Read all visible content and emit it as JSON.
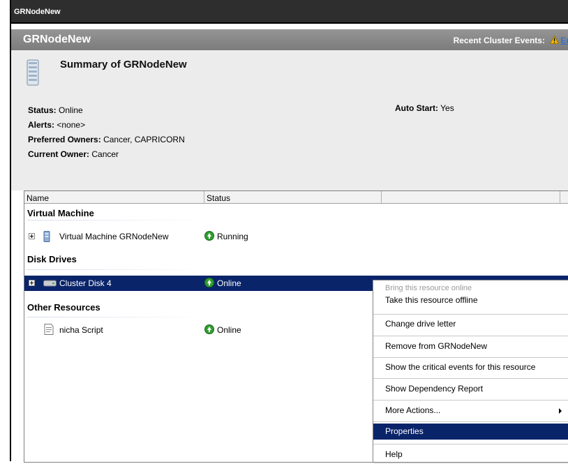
{
  "window": {
    "title": "GRNodeNew"
  },
  "header": {
    "name": "GRNodeNew",
    "recent_events_label": "Recent Cluster Events:",
    "recent_events_link": "Er"
  },
  "summary": {
    "title": "Summary of GRNodeNew",
    "status_label": "Status:",
    "status_value": "Online",
    "alerts_label": "Alerts:",
    "alerts_value": "<none>",
    "preferred_owners_label": "Preferred Owners:",
    "preferred_owners_value": "Cancer, CAPRICORN",
    "current_owner_label": "Current Owner:",
    "current_owner_value": "Cancer",
    "auto_start_label": "Auto Start:",
    "auto_start_value": "Yes"
  },
  "grid": {
    "columns": [
      "Name",
      "Status",
      "",
      ""
    ],
    "groups": [
      {
        "label": "Virtual Machine",
        "items": [
          {
            "name": "Virtual Machine GRNodeNew",
            "status": "Running"
          }
        ]
      },
      {
        "label": "Disk Drives",
        "items": [
          {
            "name": "Cluster Disk 4",
            "status": "Online"
          }
        ]
      },
      {
        "label": "Other Resources",
        "items": [
          {
            "name": "nicha Script",
            "status": "Online"
          }
        ]
      }
    ]
  },
  "context_menu": {
    "items": [
      {
        "label": "Bring this resource online",
        "state": "disabled"
      },
      {
        "label": "Take this resource offline",
        "state": "normal"
      },
      {
        "label": "Change drive letter",
        "state": "normal"
      },
      {
        "label": "Remove from GRNodeNew",
        "state": "normal"
      },
      {
        "label": "Show the critical events for this resource",
        "state": "normal"
      },
      {
        "label": "Show Dependency Report",
        "state": "normal"
      },
      {
        "label": "More Actions...",
        "state": "submenu"
      },
      {
        "label": "Properties",
        "state": "highlighted"
      },
      {
        "label": "Help",
        "state": "normal"
      }
    ]
  },
  "colors": {
    "selection": "#0a246a",
    "header": "#8a8a8a",
    "status_ok": "#2f9e2f",
    "warning": "#f2b705"
  }
}
